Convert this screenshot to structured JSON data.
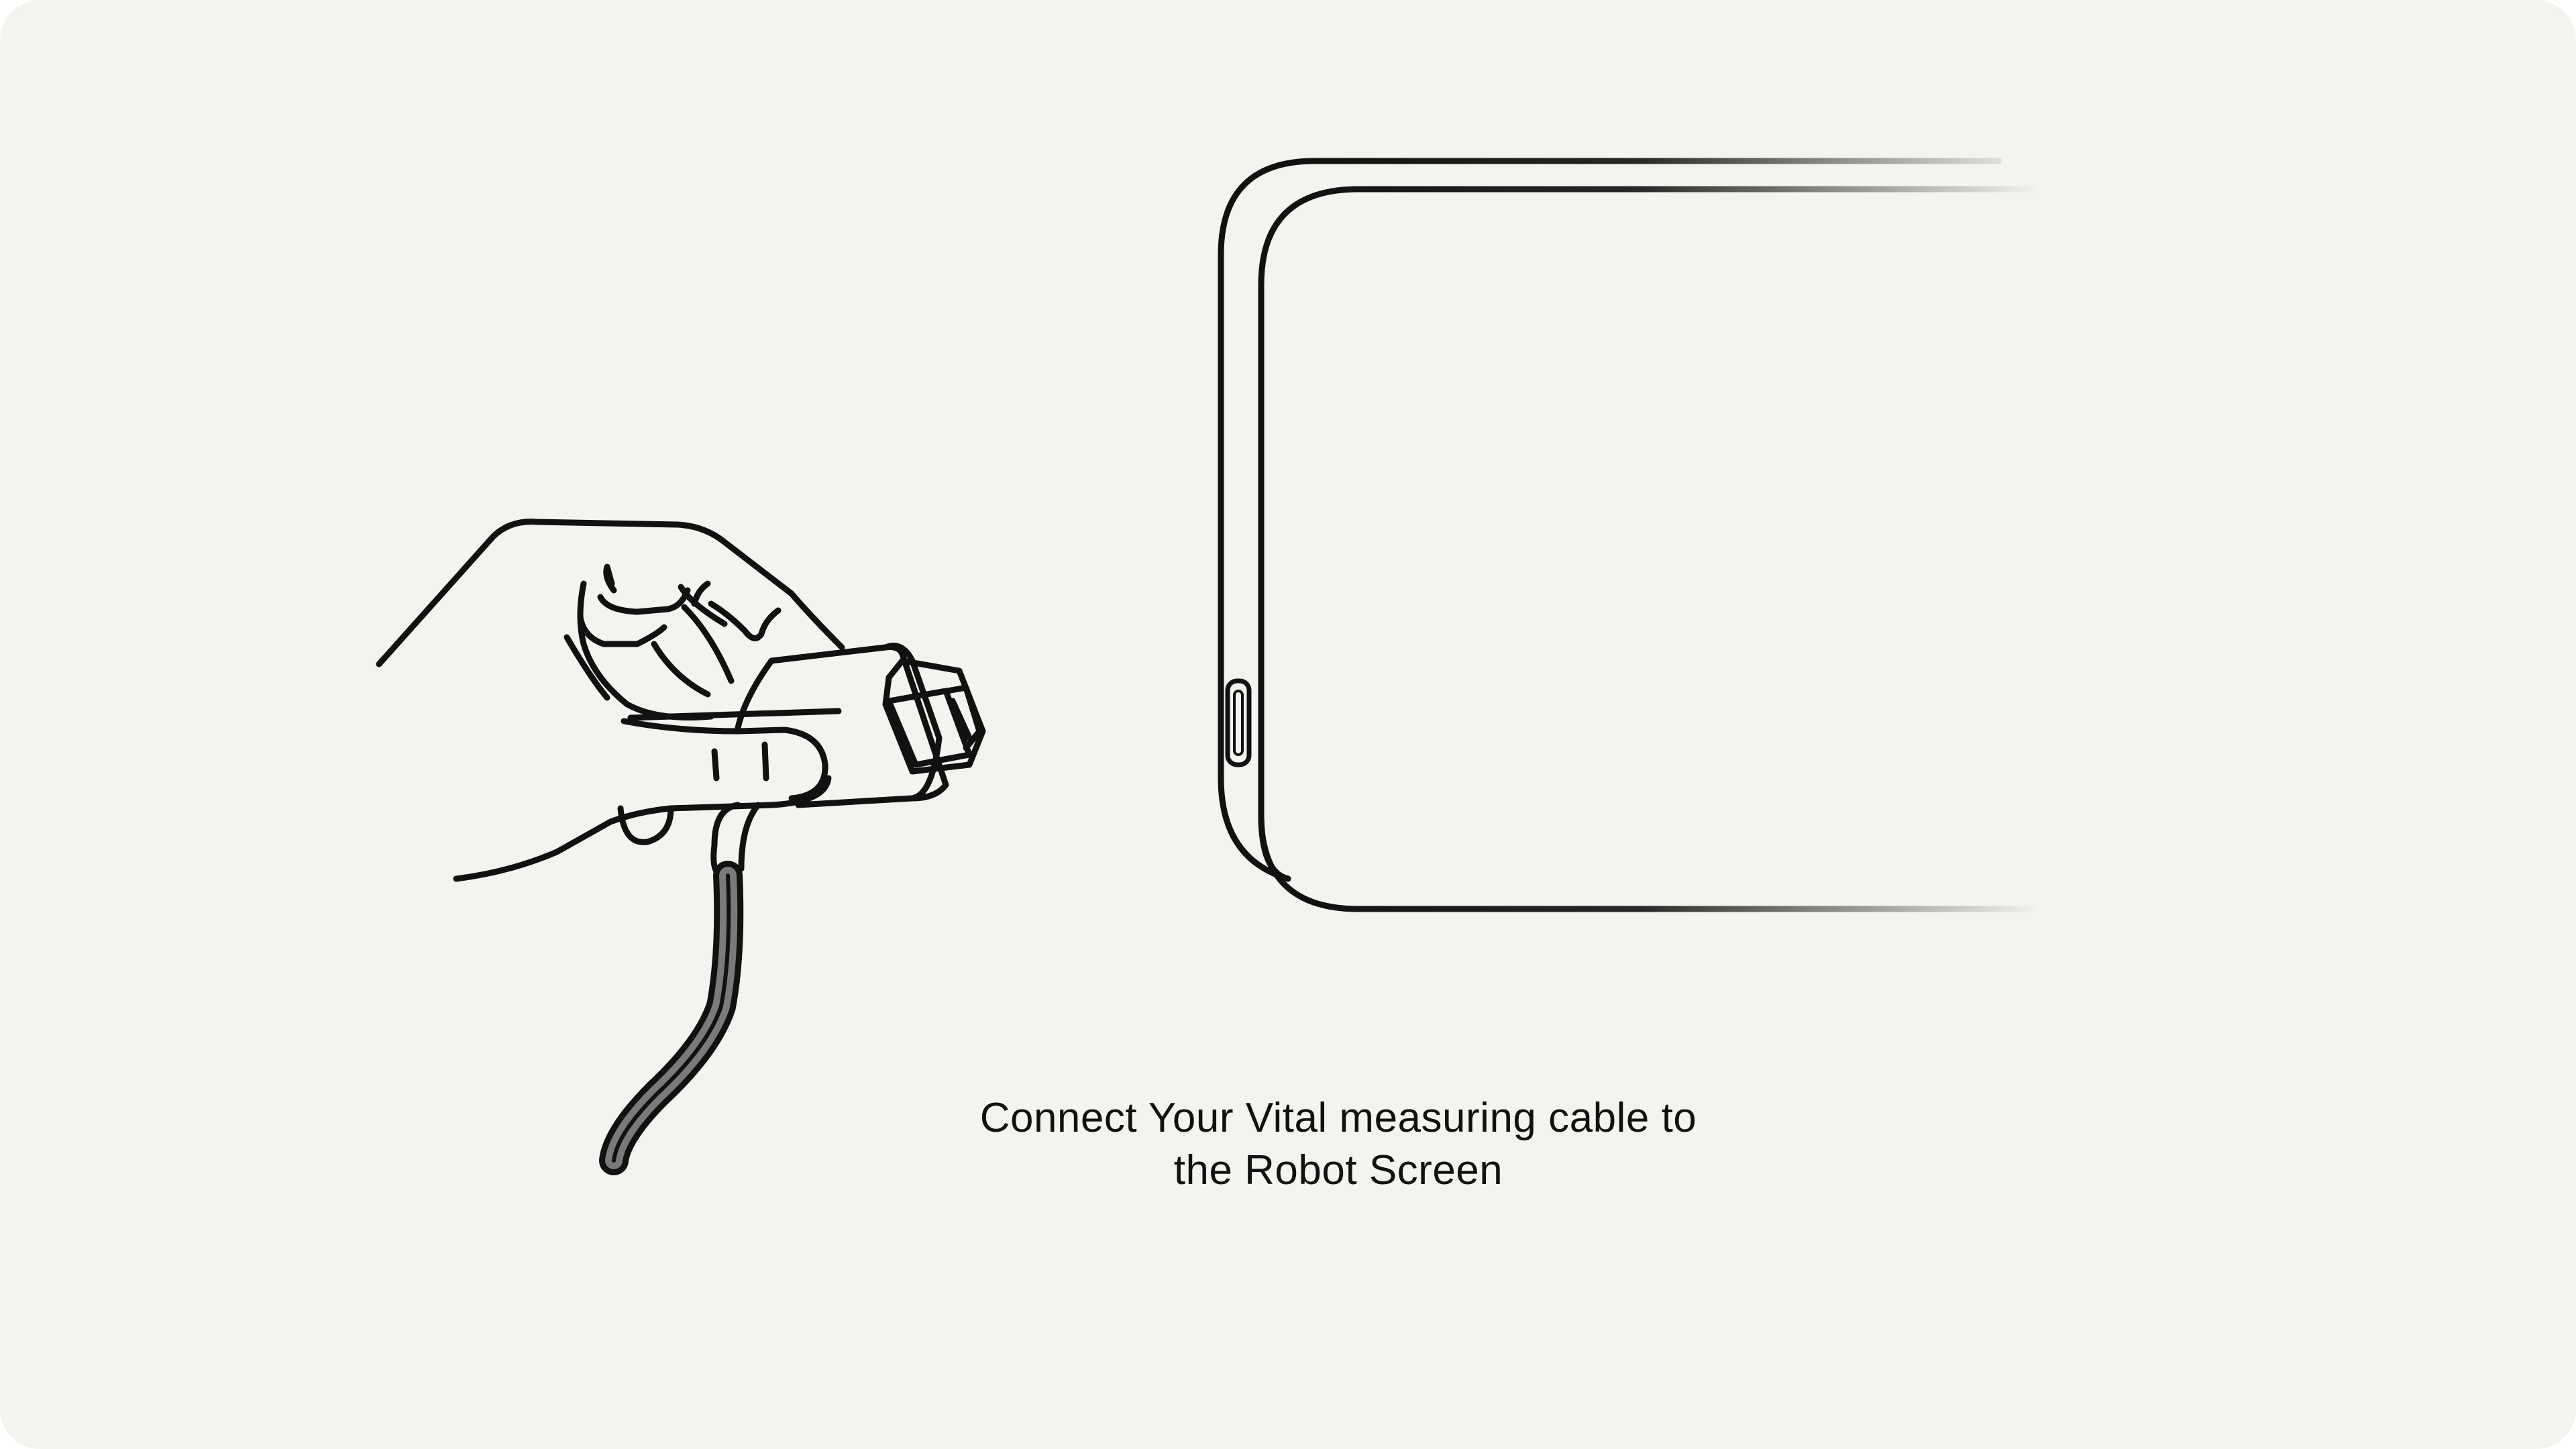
{
  "background_color": "#f4f3ef",
  "line_color": "#111111",
  "instruction": {
    "line1": "Connect Your Vital measuring cable to",
    "line2": "the Robot Screen"
  },
  "illustration": {
    "hand_icon": "hand-holding-plug-icon",
    "cable_icon": "cable-icon",
    "device_icon": "robot-screen-icon",
    "port_icon": "usb-port-icon"
  }
}
